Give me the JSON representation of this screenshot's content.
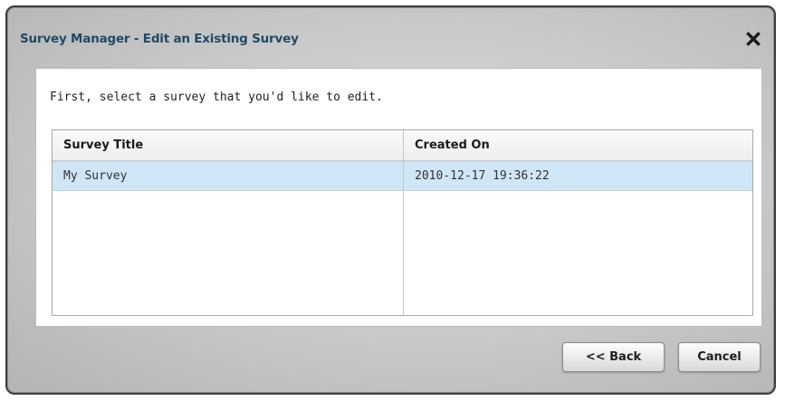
{
  "dialog": {
    "title": "Survey Manager - Edit an Existing Survey",
    "close_icon": "close-icon",
    "instruction": "First, select a survey that you'd like to edit.",
    "table": {
      "columns": [
        "Survey Title",
        "Created On"
      ],
      "rows": [
        {
          "title": "My Survey",
          "created_on": "2010-12-17 19:36:22",
          "selected": true
        }
      ]
    },
    "buttons": {
      "back_label": "<< Back",
      "cancel_label": "Cancel"
    }
  },
  "colors": {
    "title_text": "#1e4a68",
    "selected_row": "#cfe6f6",
    "dialog_border": "#3e3e3e"
  }
}
